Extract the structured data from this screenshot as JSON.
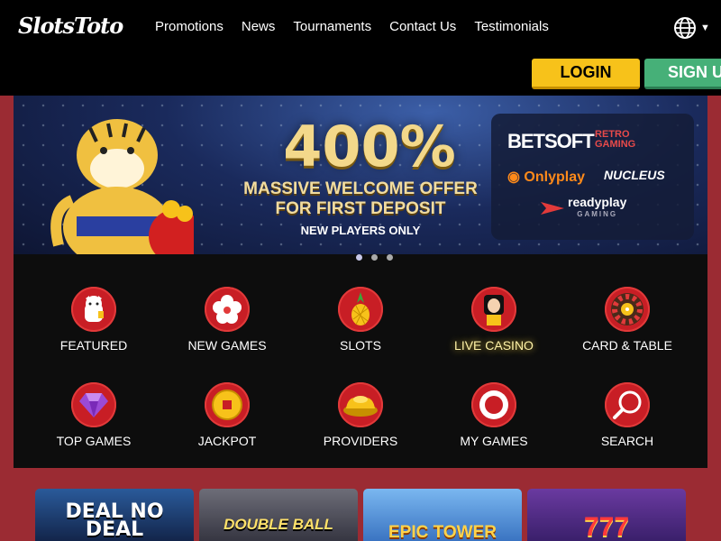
{
  "header": {
    "logo": "SlotsToto",
    "nav": [
      "Promotions",
      "News",
      "Tournaments",
      "Contact Us",
      "Testimonials"
    ],
    "language_icon": "globe-icon",
    "login_label": "LOGIN",
    "signup_label": "SIGN U"
  },
  "banner": {
    "headline": "400%",
    "line1": "MASSIVE WELCOME OFFER",
    "line2": "FOR FIRST DEPOSIT",
    "line3": "NEW PLAYERS ONLY",
    "providers": {
      "betsoft": "BETSOFT",
      "retro_1": "RETRO",
      "retro_2": "GAMING",
      "onlyplay": "Onlyplay",
      "nucleus": "NUCLEUS",
      "ready_1": "readyplay",
      "ready_2": "GAMING"
    },
    "slide_count": 3,
    "active_slide": 1
  },
  "categories": [
    {
      "label": "FEATURED",
      "icon": "lucky-cat-icon"
    },
    {
      "label": "NEW GAMES",
      "icon": "flower-icon"
    },
    {
      "label": "SLOTS",
      "icon": "pineapple-icon"
    },
    {
      "label": "LIVE CASINO",
      "icon": "dealer-icon"
    },
    {
      "label": "CARD & TABLE",
      "icon": "roulette-icon"
    },
    {
      "label": "TOP GAMES",
      "icon": "diamond-icon"
    },
    {
      "label": "JACKPOT",
      "icon": "coin-icon"
    },
    {
      "label": "PROVIDERS",
      "icon": "gold-ingot-icon"
    },
    {
      "label": "MY GAMES",
      "icon": "target-icon"
    },
    {
      "label": "SEARCH",
      "icon": "search-icon"
    }
  ],
  "games": [
    {
      "title": "DEAL NO DEAL"
    },
    {
      "title": "DOUBLE BALL"
    },
    {
      "title": "EPIC TOWER"
    },
    {
      "title": "777"
    }
  ],
  "colors": {
    "page_bg": "#9b2b33",
    "header_bg": "#000000",
    "login": "#f7c21a",
    "signup": "#46b078",
    "category_icon": "#c81e25"
  }
}
